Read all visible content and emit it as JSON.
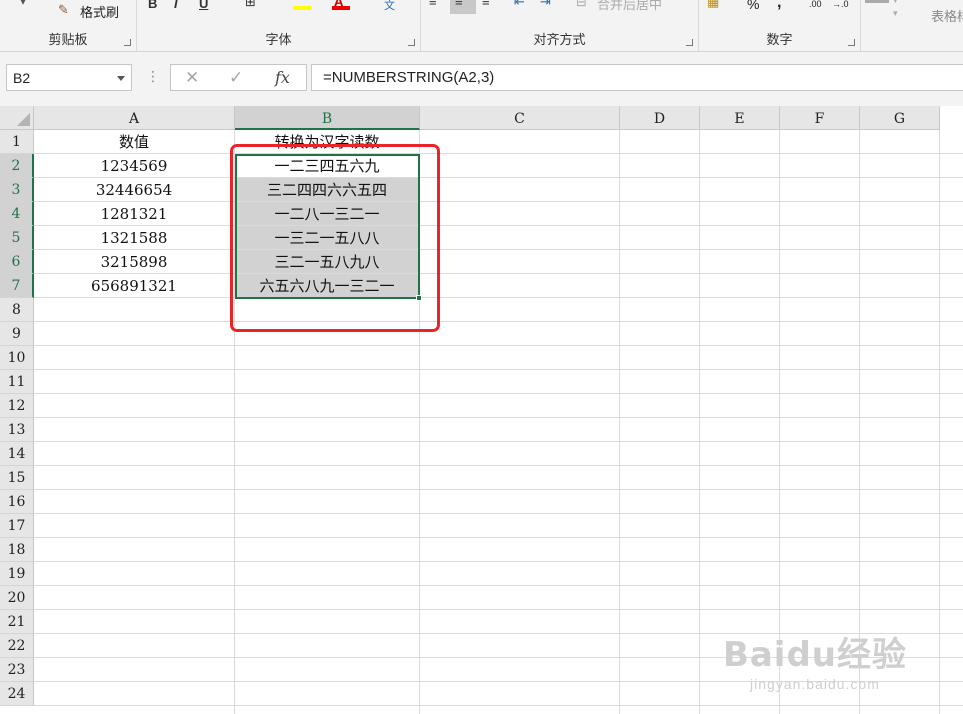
{
  "ribbon": {
    "format_painter_label": "格式刷",
    "merge_center_label": "合并后居中",
    "table_style_label": "表格样",
    "groups": {
      "clipboard": "剪贴板",
      "font": "字体",
      "alignment": "对齐方式",
      "number": "数字"
    },
    "number_format_percent": "%",
    "number_format_comma": ",",
    "decimal_increase": ".00",
    "decimal_decrease": "→.0"
  },
  "formula_bar": {
    "name_box": "B2",
    "cancel_icon": "✕",
    "enter_icon": "✓",
    "fx_label": "fx",
    "formula": "=NUMBERSTRING(A2,3)"
  },
  "sheet": {
    "columns": [
      "A",
      "B",
      "C",
      "D",
      "E",
      "F",
      "G"
    ],
    "rows": [
      "1",
      "2",
      "3",
      "4",
      "5",
      "6",
      "7",
      "8",
      "9",
      "10",
      "11",
      "12",
      "13",
      "14",
      "15",
      "16",
      "17",
      "18",
      "19",
      "20",
      "21",
      "22",
      "23",
      "24"
    ],
    "cells": {
      "A1": "数值",
      "B1": "转换为汉字读数",
      "A2": "1234569",
      "B2": "一二三四五六九",
      "A3": "32446654",
      "B3": "三二四四六六五四",
      "A4": "1281321",
      "B4": "一二八一三二一",
      "A5": "1321588",
      "B5": "一三二一五八八",
      "A6": "3215898",
      "B6": "三二一五八九八",
      "A7": "656891321",
      "B7": "六五六八九一三二一"
    },
    "selected_range": "B2:B7"
  },
  "watermark": {
    "logo": "Baidu经验",
    "url": "jingyan.baidu.com"
  },
  "colors": {
    "accent_green": "#217346",
    "annotation_red": "#e8262a"
  }
}
